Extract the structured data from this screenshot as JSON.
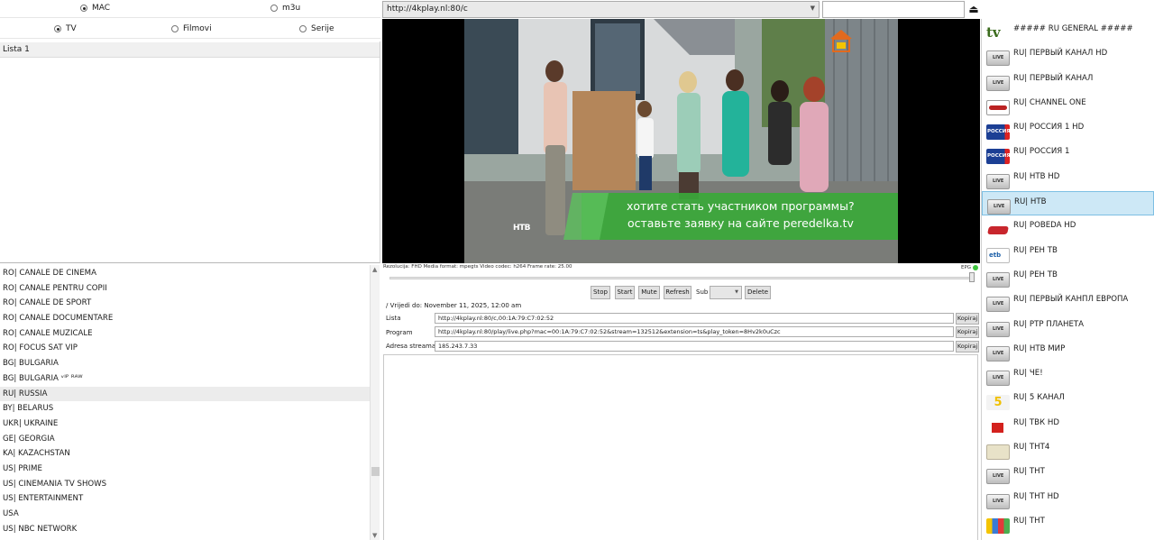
{
  "source_mode": {
    "mac_label": "MAC",
    "m3u_label": "m3u",
    "selected": "MAC"
  },
  "content_type": {
    "tv_label": "TV",
    "films_label": "Filmovi",
    "series_label": "Serije",
    "selected": "TV"
  },
  "lists": {
    "header": "Lista 1"
  },
  "categories": [
    "RO| CANALE DE CINEMA",
    "RO| CANALE PENTRU COPII",
    "RO| CANALE DE SPORT",
    "RO| CANALE DOCUMENTARE",
    "RO| CANALE MUZICALE",
    "RO| FOCUS SAT VIP",
    "BG| BULGARIA",
    "BG| BULGARIA ᵛᴵᴾ ᴿᴬᵂ",
    "RU| RUSSIA",
    "BY| BELARUS",
    "UKR| UKRAINE",
    "GE| GEORGIA",
    "KA| KAZACHSTAN",
    "US| PRIME",
    "US| CINEMANIA TV SHOWS",
    "US| ENTERTAINMENT",
    "USA",
    "US| NBC NETWORK"
  ],
  "selected_category_index": 8,
  "portal": {
    "url": "http://4kplay.nl:80/c",
    "search_value": ""
  },
  "player": {
    "overlay_line1": "хотите стать участником программы?",
    "overlay_line2": "оставьте заявку на сайте peredelka.tv",
    "channel_bug": "НТВ",
    "info": "Rezolucija: FHD Media format: mpegts Video codec: h264 Frame rate: 25.00",
    "epg_label": "EPG",
    "epg_status_color": "#3ec43e"
  },
  "controls": {
    "stop": "Stop",
    "start": "Start",
    "mute": "Mute",
    "refresh": "Refresh",
    "sub_label": "Sub",
    "sub_value": "",
    "delete": "Delete"
  },
  "details": {
    "valid_until": "/ Vrijedi do: November 11, 2025, 12:00 am",
    "list_label": "Lista",
    "list_value": "http://4kplay.nl:80/c,00:1A:79:C7:02:52",
    "program_label": "Program",
    "program_value": "http://4kplay.nl:80/play/live.php?mac=00:1A:79:C7:02:52&stream=132512&extension=ts&play_token=8Hv2k0uCzc",
    "stream_label": "Adresa streama",
    "stream_value": "185.243.7.33",
    "copy_label": "Kopiraj"
  },
  "channels": [
    {
      "name": "##### RU GENERAL #####",
      "logo": "tv-icon"
    },
    {
      "name": "RU| ПЕРВЫЙ КАНАЛ HD",
      "logo": "live-icon"
    },
    {
      "name": "RU| ПЕРВЫЙ КАНАЛ",
      "logo": "live-icon"
    },
    {
      "name": "RU| CHANNEL ONE",
      "logo": "channel-one-logo"
    },
    {
      "name": "RU| РОССИЯ 1 HD",
      "logo": "rossia-logo"
    },
    {
      "name": "RU| РОССИЯ 1",
      "logo": "rossia-logo"
    },
    {
      "name": "RU| НТВ HD",
      "logo": "live-icon"
    },
    {
      "name": "RU| НТВ",
      "logo": "live-icon"
    },
    {
      "name": "RU| POBEDA HD",
      "logo": "pobeda-logo"
    },
    {
      "name": "RU| РЕН ТВ",
      "logo": "etb-logo"
    },
    {
      "name": "RU| РЕН ТВ",
      "logo": "live-icon"
    },
    {
      "name": "RU| ПЕРВЫЙ КАНПЛ ЕВРОПА",
      "logo": "live-icon"
    },
    {
      "name": "RU| РТР ПЛАНЕТА",
      "logo": "live-icon"
    },
    {
      "name": "RU| НТВ МИР",
      "logo": "live-icon"
    },
    {
      "name": "RU| ЧЕ!",
      "logo": "live-icon"
    },
    {
      "name": "RU| 5 КАНАЛ",
      "logo": "five-logo"
    },
    {
      "name": "RU| ТВК HD",
      "logo": "tvk-logo"
    },
    {
      "name": "RU| THT4",
      "logo": "tnt4-logo"
    },
    {
      "name": "RU| THT",
      "logo": "live-icon"
    },
    {
      "name": "RU| THT HD",
      "logo": "live-icon"
    },
    {
      "name": "RU| THT",
      "logo": "tnt-logo"
    }
  ],
  "selected_channel_index": 7,
  "colors": {
    "selection": "#cde8f6",
    "selection_border": "#7dbfe3",
    "overlay_green": "#3aa83a"
  }
}
